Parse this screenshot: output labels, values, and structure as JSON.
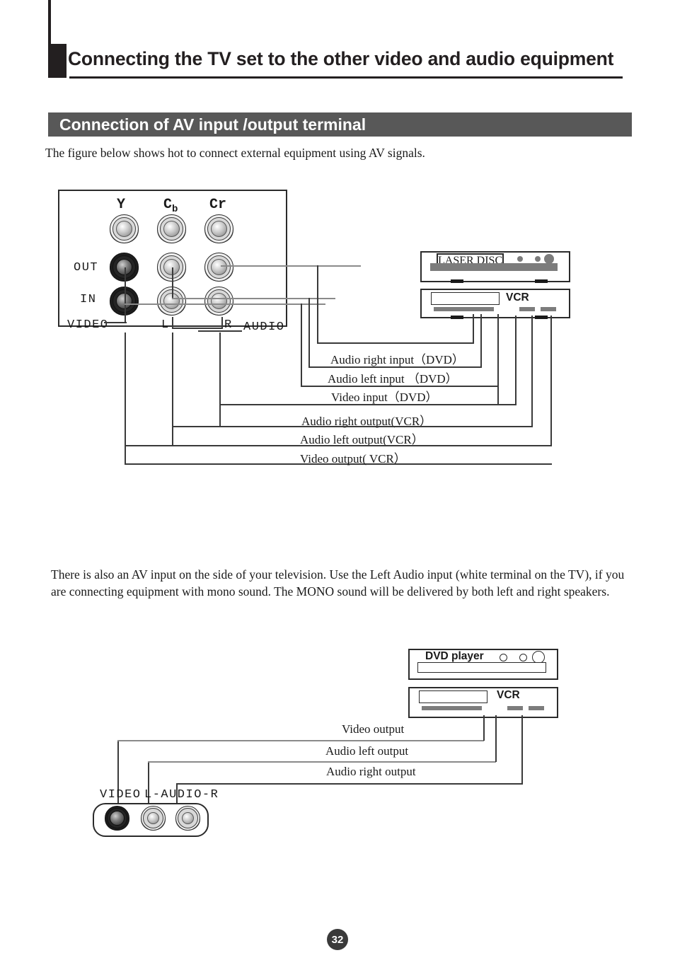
{
  "header": {
    "title": "Connecting the TV set to the other video and audio equipment",
    "section_title": "Connection of AV input /output terminal",
    "intro": "The figure below shows hot to connect external equipment using AV signals."
  },
  "tv_panel": {
    "component_labels": {
      "y": "Y",
      "cb": "C",
      "cb_sub": "b",
      "cr": "Cr"
    },
    "row_labels": {
      "out": "OUT",
      "in": "IN"
    },
    "jack_labels": {
      "video": "VIDEO",
      "left": "L",
      "right": "R",
      "audio": "AUDIO"
    }
  },
  "devices_top": {
    "laser_disc": "LASER DISC",
    "vcr": "VCR"
  },
  "connections_top": [
    {
      "label": "Audio right   input（DVD）"
    },
    {
      "label": "Audio left  input （DVD）"
    },
    {
      "label": "Video   input（DVD）"
    },
    {
      "label": "Audio right output(VCR）"
    },
    {
      "label": "Audio left output(VCR）"
    },
    {
      "label": "Video output( VCR）"
    }
  ],
  "body_text": {
    "paragraph": "There is also an AV input on the  side of your television.  Use the Left Audio input (white terminal on the TV), if you are connecting equipment with mono sound. The MONO sound will be delivered by both left and right speakers."
  },
  "devices_bottom": {
    "dvd_player": "DVD player",
    "vcr": "VCR"
  },
  "connections_bottom": [
    {
      "label": "Video output"
    },
    {
      "label": "Audio left output"
    },
    {
      "label": "Audio right output"
    }
  ],
  "side_panel": {
    "video_label": "VIDEO",
    "audio_label": "L-AUDIO-R"
  },
  "footer": {
    "page_number": "32"
  },
  "colors": {
    "ink": "#231f20",
    "section_bar": "#585858",
    "line": "#3a3a3a",
    "device_slot": "#7c7c7c"
  }
}
